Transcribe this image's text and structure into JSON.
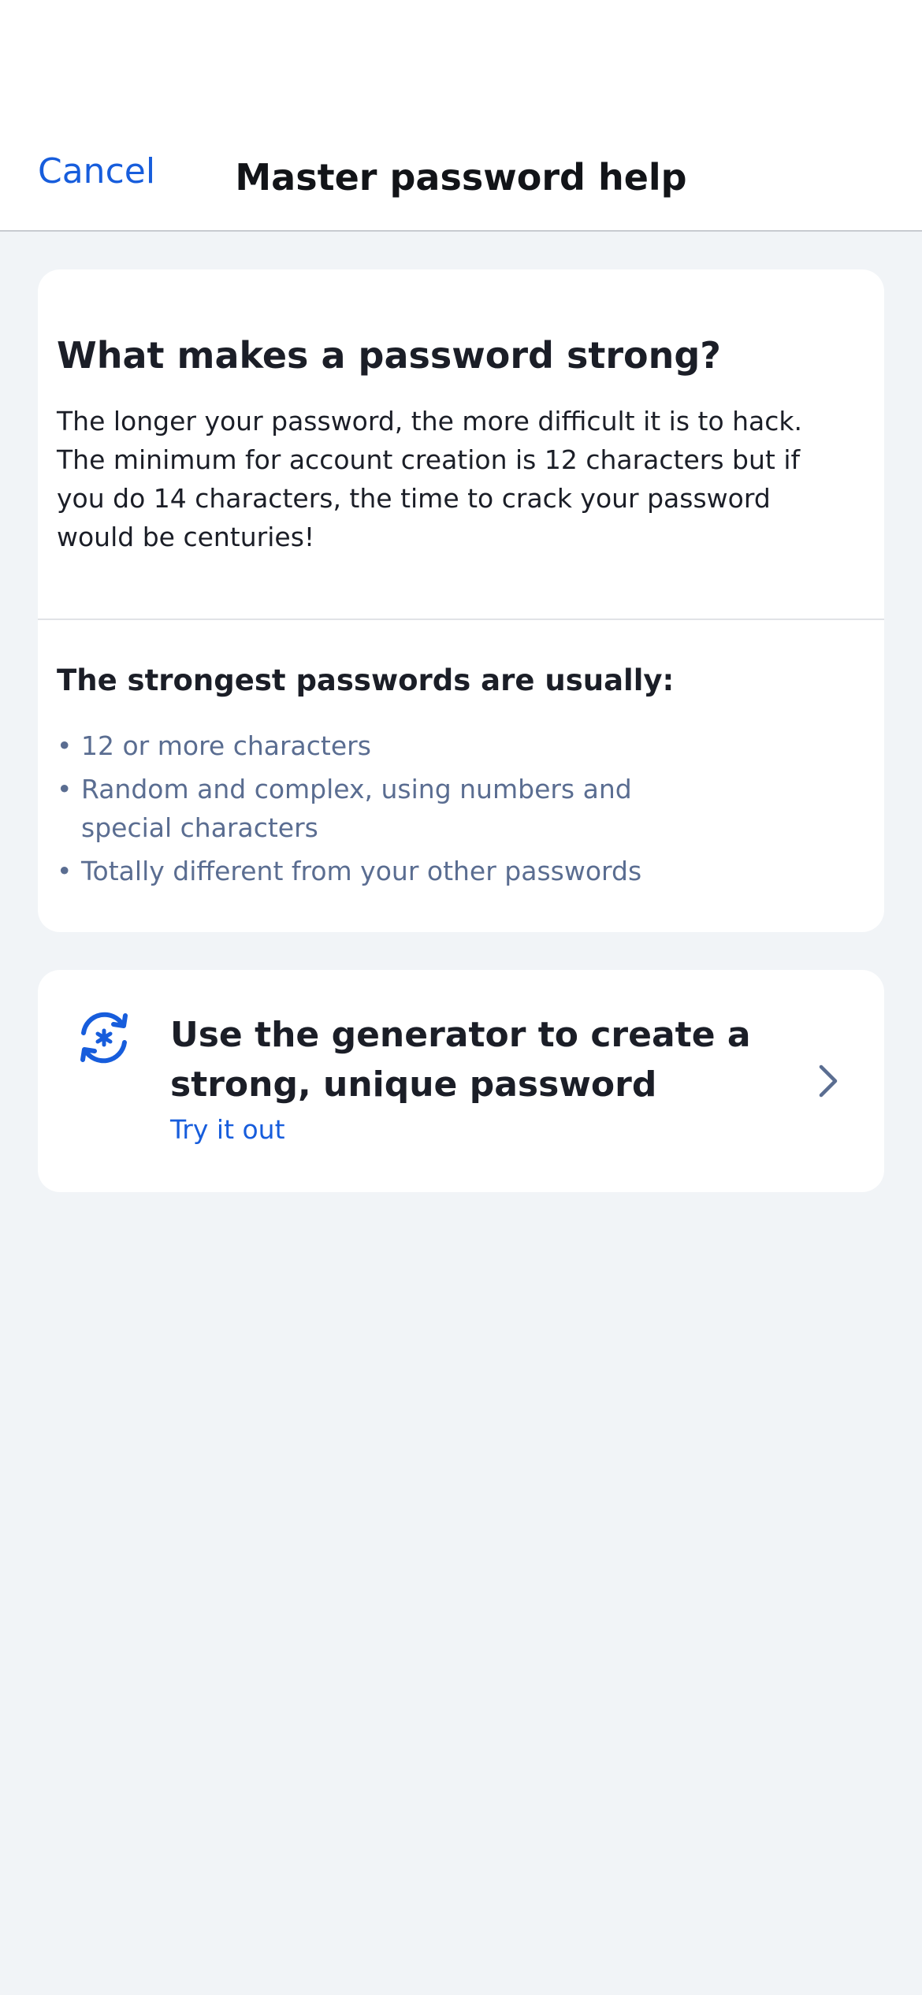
{
  "header": {
    "cancel_label": "Cancel",
    "title": "Master password help"
  },
  "info_card": {
    "heading": "What makes a password strong?",
    "body": "The longer your password, the more difficult it is to hack. The minimum for account creation is 12 characters but if you do 14 characters, the time to crack your password would be centuries!",
    "list_heading": "The strongest passwords are usually:",
    "tips": [
      "12 or more characters",
      "Random and complex, using numbers and special characters",
      "Totally different from your other passwords"
    ],
    "bullet": "•"
  },
  "generator_card": {
    "icon": "generator-refresh-icon",
    "title": "Use the generator to create a strong, unique password",
    "link_label": "Try it out",
    "chevron_icon": "chevron-right-icon"
  },
  "colors": {
    "accent": "#175ddc",
    "background": "#f1f4f7",
    "card": "#ffffff",
    "text": "#1b1e27",
    "muted_text": "#5a6d91",
    "chevron": "#5a6d91"
  }
}
